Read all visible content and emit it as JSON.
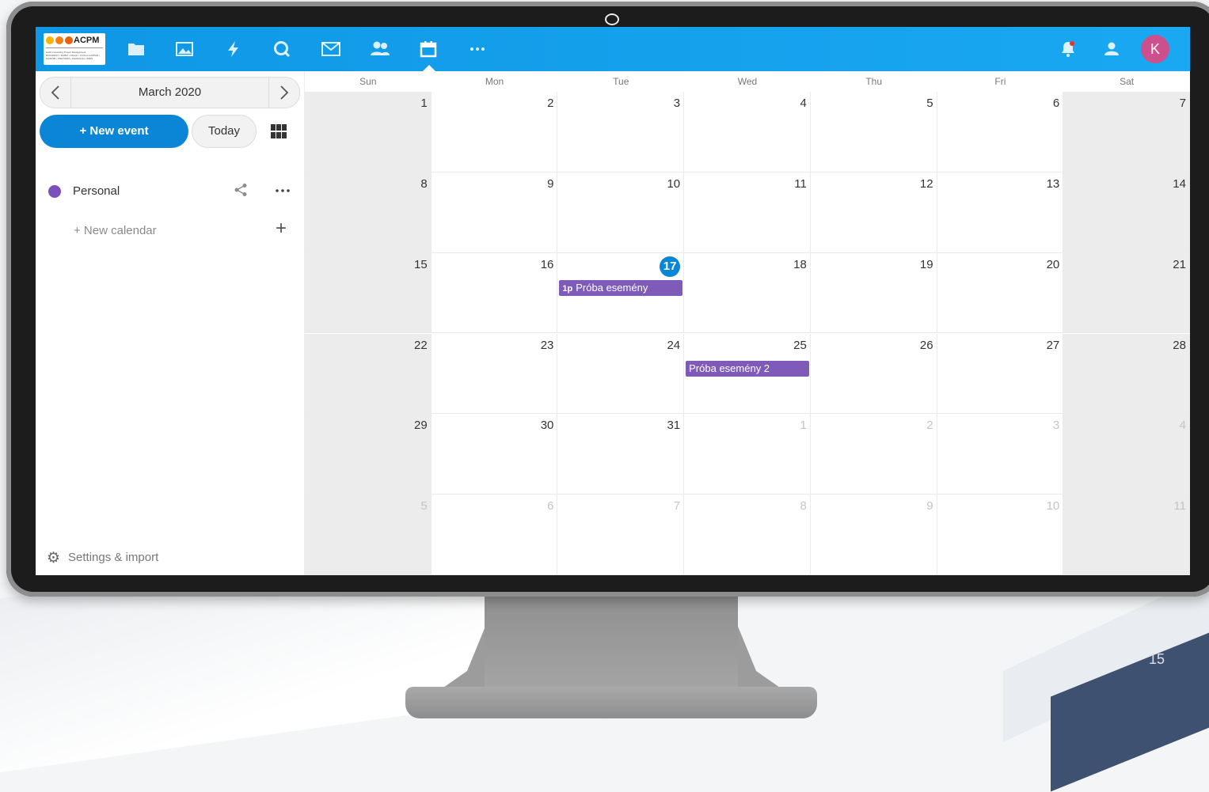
{
  "logo": {
    "brand": "ACPM",
    "tagline": "Audit Consulting Project Management",
    "cities": "BUDAPEST • DUBAI • KIGALI • KUALA LUMPUR • NAIROBI • PRETORIA • SHANGHAI • WIEN",
    "dot_colors": [
      "#f5b500",
      "#f57f17",
      "#e8600e"
    ]
  },
  "header": {
    "nav_icons": [
      "folder-icon",
      "image-icon",
      "activity-icon",
      "talk-icon",
      "mail-icon",
      "contacts-icon",
      "calendar-icon",
      "more-apps-icon"
    ],
    "active_app": "calendar-icon",
    "avatar_initial": "K",
    "accent_color": "#0f97e5",
    "avatar_color": "#cd4f8b"
  },
  "sidebar": {
    "month_label": "March 2020",
    "new_event_label": "+ New event",
    "today_label": "Today",
    "calendars": [
      {
        "name": "Personal",
        "color": "#7b4fbc"
      }
    ],
    "new_calendar_label": "+ New calendar",
    "settings_label": "Settings & import"
  },
  "calendar": {
    "day_names": [
      "Sun",
      "Mon",
      "Tue",
      "Wed",
      "Thu",
      "Fri",
      "Sat"
    ],
    "today": 17,
    "weeks": [
      [
        {
          "d": "1"
        },
        {
          "d": "2"
        },
        {
          "d": "3"
        },
        {
          "d": "4"
        },
        {
          "d": "5"
        },
        {
          "d": "6"
        },
        {
          "d": "7"
        }
      ],
      [
        {
          "d": "8"
        },
        {
          "d": "9"
        },
        {
          "d": "10"
        },
        {
          "d": "11"
        },
        {
          "d": "12"
        },
        {
          "d": "13"
        },
        {
          "d": "14"
        }
      ],
      [
        {
          "d": "15"
        },
        {
          "d": "16"
        },
        {
          "d": "17"
        },
        {
          "d": "18"
        },
        {
          "d": "19"
        },
        {
          "d": "20"
        },
        {
          "d": "21"
        }
      ],
      [
        {
          "d": "22"
        },
        {
          "d": "23"
        },
        {
          "d": "24"
        },
        {
          "d": "25"
        },
        {
          "d": "26"
        },
        {
          "d": "27"
        },
        {
          "d": "28"
        }
      ],
      [
        {
          "d": "29"
        },
        {
          "d": "30"
        },
        {
          "d": "31"
        },
        {
          "d": "1",
          "other": true
        },
        {
          "d": "2",
          "other": true
        },
        {
          "d": "3",
          "other": true
        },
        {
          "d": "4",
          "other": true
        }
      ],
      [
        {
          "d": "5",
          "other": true
        },
        {
          "d": "6",
          "other": true
        },
        {
          "d": "7",
          "other": true
        },
        {
          "d": "8",
          "other": true
        },
        {
          "d": "9",
          "other": true
        },
        {
          "d": "10",
          "other": true
        },
        {
          "d": "11",
          "other": true
        }
      ]
    ],
    "events": [
      {
        "week": 2,
        "day": 2,
        "time": "1p",
        "title": "Próba esemény"
      },
      {
        "week": 3,
        "day": 3,
        "time": "",
        "title": "Próba esemény 2"
      }
    ],
    "event_color": "#7e5bb9"
  },
  "page_number": "15"
}
